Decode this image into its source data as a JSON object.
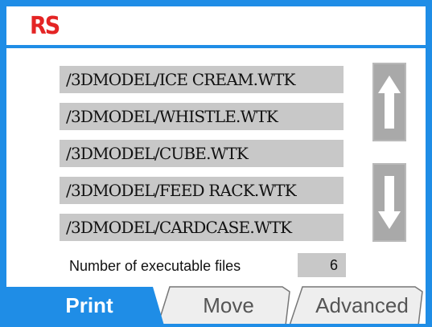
{
  "header": {
    "logo_text": "RS",
    "logo_color": "#e42424"
  },
  "theme": {
    "accent": "#1f8de6",
    "row_bg": "#c8c8c8",
    "button_bg": "#a9a9a9"
  },
  "files": [
    {
      "path": "/3DMODEL/ICE CREAM.WTK"
    },
    {
      "path": "/3DMODEL/WHISTLE.WTK"
    },
    {
      "path": "/3DMODEL/CUBE.WTK"
    },
    {
      "path": "/3DMODEL/FEED RACK.WTK"
    },
    {
      "path": "/3DMODEL/CARDCASE.WTK"
    }
  ],
  "scroll": {
    "up_icon": "arrow-up-icon",
    "down_icon": "arrow-down-icon"
  },
  "status": {
    "count_label": "Number of executable files",
    "count_value": "6"
  },
  "tabs": [
    {
      "label": "Print",
      "active": true
    },
    {
      "label": "Move",
      "active": false
    },
    {
      "label": "Advanced",
      "active": false
    }
  ]
}
